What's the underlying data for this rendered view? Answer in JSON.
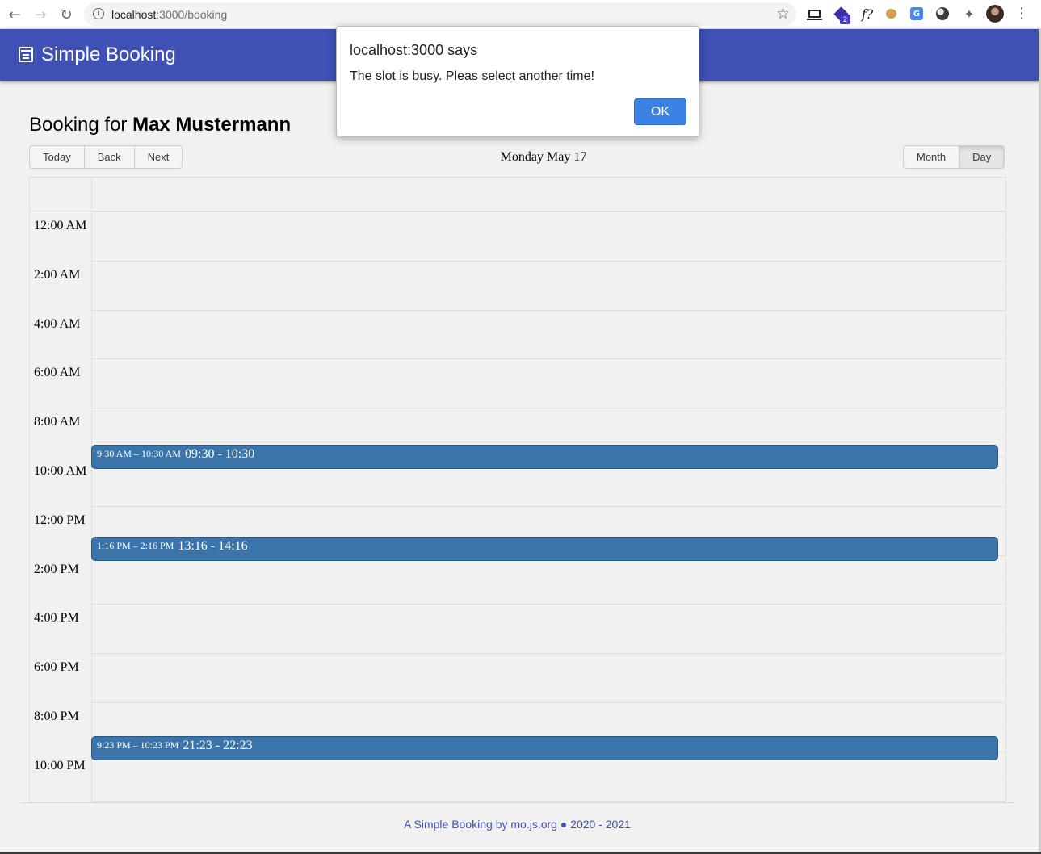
{
  "browser": {
    "url_host": "localhost",
    "url_rest": ":3000/booking",
    "extension_badge": "2",
    "fx_label": "f?",
    "translate_label": "G"
  },
  "header": {
    "title": "Simple Booking",
    "color": "#3f51b5"
  },
  "booking": {
    "prefix": "Booking for ",
    "name": "Max Mustermann"
  },
  "toolbar": {
    "today": "Today",
    "back": "Back",
    "next": "Next",
    "label": "Monday May 17",
    "month": "Month",
    "day": "Day",
    "active_view": "Day"
  },
  "calendar": {
    "time_labels": [
      "12:00 AM",
      "2:00 AM",
      "4:00 AM",
      "6:00 AM",
      "8:00 AM",
      "10:00 AM",
      "12:00 PM",
      "2:00 PM",
      "4:00 PM",
      "6:00 PM",
      "8:00 PM",
      "10:00 PM"
    ],
    "events": [
      {
        "time": "9:30 AM – 10:30 AM",
        "title": "09:30 - 10:30",
        "start_hour": 9.5,
        "end_hour": 10.5
      },
      {
        "time": "1:16 PM – 2:16 PM",
        "title": "13:16 - 14:16",
        "start_hour": 13.27,
        "end_hour": 14.27
      },
      {
        "time": "9:23 PM – 10:23 PM",
        "title": "21:23 - 22:23",
        "start_hour": 21.38,
        "end_hour": 22.38
      }
    ],
    "event_color": "#3a74a9"
  },
  "footer": {
    "text": "A Simple Booking by mo.js.org ● 2020 - 2021"
  },
  "dialog": {
    "title": "localhost:3000 says",
    "message": "The slot is busy. Pleas select another time!",
    "ok": "OK"
  }
}
